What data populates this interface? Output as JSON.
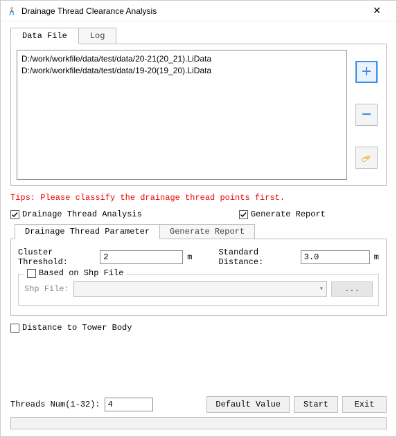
{
  "window": {
    "title": "Drainage Thread Clearance Analysis",
    "close_glyph": "✕"
  },
  "tabs": {
    "data_file": "Data File",
    "log": "Log"
  },
  "files": [
    "D:/work/workfile/data/test/data/20-21(20_21).LiData",
    "D:/work/workfile/data/test/data/19-20(19_20).LiData"
  ],
  "tips": "Tips: Please classify the drainage thread points first.",
  "checks": {
    "drainage_analysis": "Drainage Thread Analysis",
    "generate_report": "Generate Report"
  },
  "sub_tabs": {
    "param": "Drainage Thread Parameter",
    "report": "Generate Report"
  },
  "params": {
    "cluster_label": "Cluster Threshold:",
    "cluster_value": "2",
    "cluster_unit": "m",
    "std_label": "Standard Distance:",
    "std_value": "3.0",
    "std_unit": "m",
    "shp_group": "Based on Shp File",
    "shp_label": "Shp File:",
    "browse": "...",
    "dist_tower": "Distance to Tower Body"
  },
  "footer": {
    "threads_label": "Threads Num(1-32):",
    "threads_value": "4",
    "default_btn": "Default Value",
    "start_btn": "Start",
    "exit_btn": "Exit"
  }
}
